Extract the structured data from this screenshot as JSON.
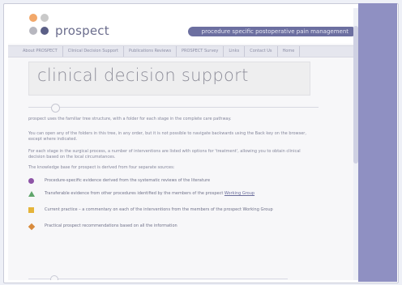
{
  "header": {
    "logo_text": "prospect",
    "tagline": "procedure specific postoperative pain management"
  },
  "nav": {
    "items": [
      "About PROSPECT",
      "Clinical Decision Support",
      "Publications Reviews",
      "PROSPECT Survey",
      "Links",
      "Contact Us",
      "Home"
    ]
  },
  "page": {
    "title": "clinical decision support",
    "paragraphs": [
      "prospect uses the familiar tree structure, with a folder for each stage in the complete care pathway.",
      "You can open any of the folders in this tree, in any order, but it is not possible to navigate backwards using the Back key on the browser, except where indicated.",
      "For each stage in the surgical process, a number of interventions are listed with options for 'treatment', allowing you to obtain clinical decision based on the local circumstances.",
      "The knowledge base for prospect is derived from four separate sources:"
    ],
    "sources": [
      {
        "icon": "purple-circle-icon",
        "text": "Procedure-specific evidence derived from the systematic reviews of the literature"
      },
      {
        "icon": "green-triangle-icon",
        "text": "Transferable evidence from other procedures identified by the members of the prospect",
        "link": "Working Group"
      },
      {
        "icon": "yellow-square-icon",
        "text": "Current practice – a commentary on each of the interventions from the members of the prospect Working Group"
      },
      {
        "icon": "orange-diamond-icon",
        "text": "Practical prospect recommendations based on all the information"
      }
    ]
  },
  "colors": {
    "accent": "#6c6fa0",
    "sidebar": "#8f90c2",
    "title": "#8d8d99"
  }
}
